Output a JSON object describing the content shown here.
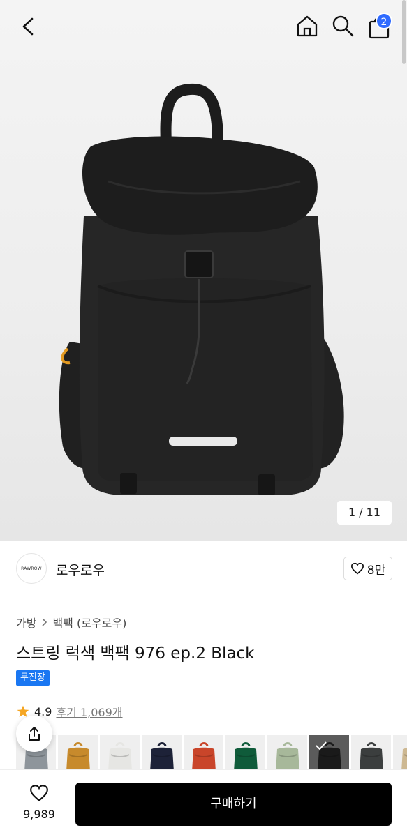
{
  "header": {
    "cart_count": "2"
  },
  "gallery": {
    "counter": "1 / 11"
  },
  "brand": {
    "logo_text": "RAWROW",
    "name": "로우로우",
    "likes": "8만"
  },
  "breadcrumb": {
    "category": "가방",
    "subcategory": "백팩 (로우로우)"
  },
  "product": {
    "title": "스트링 럭색 백팩 976 ep.2 Black",
    "tag": "무진장",
    "rating": "4.9",
    "reviews": "후기 1,069개"
  },
  "swatches": [
    {
      "name": "gray",
      "color": "#8e959b"
    },
    {
      "name": "mustard",
      "color": "#c78a2c"
    },
    {
      "name": "white",
      "color": "#e6e6e3"
    },
    {
      "name": "navy",
      "color": "#1d2238"
    },
    {
      "name": "orange-red",
      "color": "#c9452a"
    },
    {
      "name": "green",
      "color": "#0f5b3a"
    },
    {
      "name": "sage",
      "color": "#a7b89a"
    },
    {
      "name": "black",
      "color": "#1a1a1a",
      "selected": true
    },
    {
      "name": "charcoal",
      "color": "#3b3e3e"
    },
    {
      "name": "beige",
      "color": "#cdb892"
    }
  ],
  "bottom_bar": {
    "wish_count": "9,989",
    "buy_label": "구매하기"
  },
  "colors": {
    "accent_blue": "#1a77f2",
    "badge_blue": "#2f6bff",
    "star": "#f5a623",
    "buy_bg": "#000000"
  }
}
